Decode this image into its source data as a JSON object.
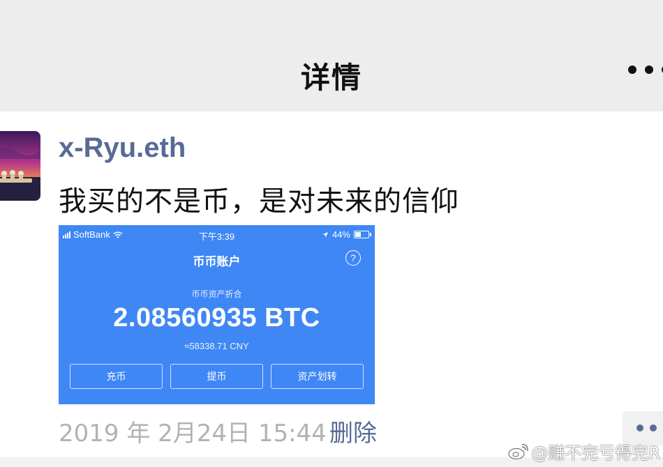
{
  "nav": {
    "title": "详情",
    "more_icon": "more-dots-icon"
  },
  "post": {
    "username": "x-Ryu.eth",
    "text": "我买的不是币，是对未来的信仰",
    "date": "2019 年 2月24日  15:44",
    "delete_label": "删除",
    "comment_icon": "comment-dots-icon"
  },
  "screenshot": {
    "status_bar": {
      "carrier": "SoftBank",
      "time": "下午3:39",
      "battery": "44%"
    },
    "app_title": "币币账户",
    "asset_label": "币币资产折合",
    "btc_value": "2.08560935 BTC",
    "cny_value": "≈58338.71 CNY",
    "buttons": [
      "充币",
      "提币",
      "资产划转"
    ],
    "accent_color": "#3f87f5"
  },
  "watermark": "@赚不完亏得完R",
  "colors": {
    "nav_bg": "#ededed",
    "link": "#576b95",
    "timestamp": "#b2b2b2"
  }
}
